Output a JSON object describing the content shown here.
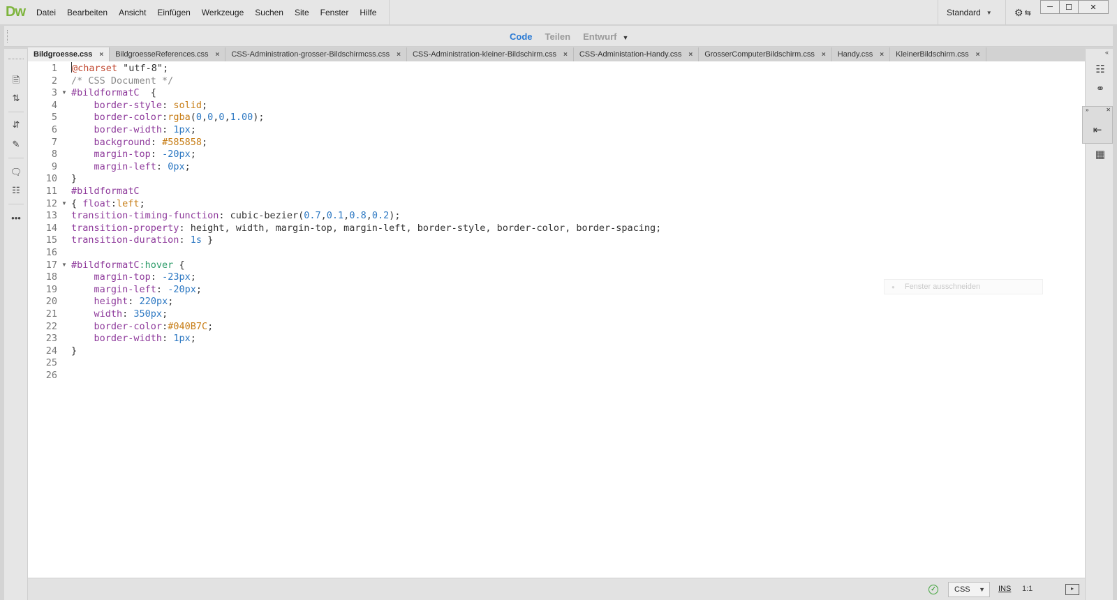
{
  "app": {
    "logo": "Dw"
  },
  "menu": [
    "Datei",
    "Bearbeiten",
    "Ansicht",
    "Einfügen",
    "Werkzeuge",
    "Suchen",
    "Site",
    "Fenster",
    "Hilfe"
  ],
  "workspace": {
    "label": "Standard"
  },
  "view_tabs": [
    {
      "label": "Code",
      "active": true
    },
    {
      "label": "Teilen",
      "active": false
    },
    {
      "label": "Entwurf",
      "active": false
    }
  ],
  "doc_tabs": [
    {
      "label": "Bildgroesse.css",
      "active": true
    },
    {
      "label": "BildgroesseReferences.css",
      "active": false
    },
    {
      "label": "CSS-Administration-grosser-Bildschirmcss.css",
      "active": false
    },
    {
      "label": "CSS-Administration-kleiner-Bildschirm.css",
      "active": false
    },
    {
      "label": "CSS-Administation-Handy.css",
      "active": false
    },
    {
      "label": "GrosserComputerBildschirm.css",
      "active": false
    },
    {
      "label": "Handy.css",
      "active": false
    },
    {
      "label": "KleinerBildschirm.css",
      "active": false
    }
  ],
  "editor": {
    "lines": [
      [
        [
          "at",
          "@charset"
        ],
        [
          "str",
          " \"utf-8\""
        ],
        [
          "plain",
          ";"
        ]
      ],
      [
        [
          "com",
          "/* CSS Document */"
        ]
      ],
      [
        [
          "sel",
          "#bildformatC"
        ],
        [
          "plain",
          "  {"
        ]
      ],
      [
        [
          "plain",
          "    "
        ],
        [
          "prop",
          "border-style"
        ],
        [
          "plain",
          ": "
        ],
        [
          "val",
          "solid"
        ],
        [
          "plain",
          ";"
        ]
      ],
      [
        [
          "plain",
          "    "
        ],
        [
          "prop",
          "border-color"
        ],
        [
          "plain",
          ":"
        ],
        [
          "val",
          "rgba"
        ],
        [
          "plain",
          "("
        ],
        [
          "num",
          "0"
        ],
        [
          "plain",
          ","
        ],
        [
          "num",
          "0"
        ],
        [
          "plain",
          ","
        ],
        [
          "num",
          "0"
        ],
        [
          "plain",
          ","
        ],
        [
          "num",
          "1.00"
        ],
        [
          "plain",
          ");"
        ]
      ],
      [
        [
          "plain",
          "    "
        ],
        [
          "prop",
          "border-width"
        ],
        [
          "plain",
          ": "
        ],
        [
          "num",
          "1px"
        ],
        [
          "plain",
          ";"
        ]
      ],
      [
        [
          "plain",
          "    "
        ],
        [
          "prop",
          "background"
        ],
        [
          "plain",
          ": "
        ],
        [
          "val",
          "#585858"
        ],
        [
          "plain",
          ";"
        ]
      ],
      [
        [
          "plain",
          "    "
        ],
        [
          "prop",
          "margin-top"
        ],
        [
          "plain",
          ": "
        ],
        [
          "num",
          "-20px"
        ],
        [
          "plain",
          ";"
        ]
      ],
      [
        [
          "plain",
          "    "
        ],
        [
          "prop",
          "margin-left"
        ],
        [
          "plain",
          ": "
        ],
        [
          "num",
          "0px"
        ],
        [
          "plain",
          ";"
        ]
      ],
      [
        [
          "plain",
          "}"
        ]
      ],
      [
        [
          "sel",
          "#bildformatC"
        ]
      ],
      [
        [
          "plain",
          "{ "
        ],
        [
          "prop",
          "float"
        ],
        [
          "plain",
          ":"
        ],
        [
          "val",
          "left"
        ],
        [
          "plain",
          ";"
        ]
      ],
      [
        [
          "prop",
          "transition-timing-function"
        ],
        [
          "plain",
          ": cubic-bezier("
        ],
        [
          "num",
          "0.7"
        ],
        [
          "plain",
          ","
        ],
        [
          "num",
          "0.1"
        ],
        [
          "plain",
          ","
        ],
        [
          "num",
          "0.8"
        ],
        [
          "plain",
          ","
        ],
        [
          "num",
          "0.2"
        ],
        [
          "plain",
          ");"
        ]
      ],
      [
        [
          "prop",
          "transition-property"
        ],
        [
          "plain",
          ": height, width, margin-top, margin-left, border-style, border-color, border-spacing;"
        ]
      ],
      [
        [
          "prop",
          "transition-duration"
        ],
        [
          "plain",
          ": "
        ],
        [
          "num",
          "1s"
        ],
        [
          "plain",
          " }"
        ]
      ],
      [],
      [
        [
          "sel",
          "#bildformatC"
        ],
        [
          "pseudo",
          ":hover"
        ],
        [
          "plain",
          " {"
        ]
      ],
      [
        [
          "plain",
          "    "
        ],
        [
          "prop",
          "margin-top"
        ],
        [
          "plain",
          ": "
        ],
        [
          "num",
          "-23px"
        ],
        [
          "plain",
          ";"
        ]
      ],
      [
        [
          "plain",
          "    "
        ],
        [
          "prop",
          "margin-left"
        ],
        [
          "plain",
          ": "
        ],
        [
          "num",
          "-20px"
        ],
        [
          "plain",
          ";"
        ]
      ],
      [
        [
          "plain",
          "    "
        ],
        [
          "prop",
          "height"
        ],
        [
          "plain",
          ": "
        ],
        [
          "num",
          "220px"
        ],
        [
          "plain",
          ";"
        ]
      ],
      [
        [
          "plain",
          "    "
        ],
        [
          "prop",
          "width"
        ],
        [
          "plain",
          ": "
        ],
        [
          "num",
          "350px"
        ],
        [
          "plain",
          ";"
        ]
      ],
      [
        [
          "plain",
          "    "
        ],
        [
          "prop",
          "border-color"
        ],
        [
          "plain",
          ":"
        ],
        [
          "val",
          "#040B7C"
        ],
        [
          "plain",
          ";"
        ]
      ],
      [
        [
          "plain",
          "    "
        ],
        [
          "prop",
          "border-width"
        ],
        [
          "plain",
          ": "
        ],
        [
          "num",
          "1px"
        ],
        [
          "plain",
          ";"
        ]
      ],
      [
        [
          "plain",
          "}"
        ]
      ],
      [],
      []
    ],
    "fold_lines": [
      3,
      12,
      17
    ],
    "ghost_hint": "Fenster ausschneiden"
  },
  "statusbar": {
    "language": "CSS",
    "mode": "INS",
    "position": "1:1"
  }
}
